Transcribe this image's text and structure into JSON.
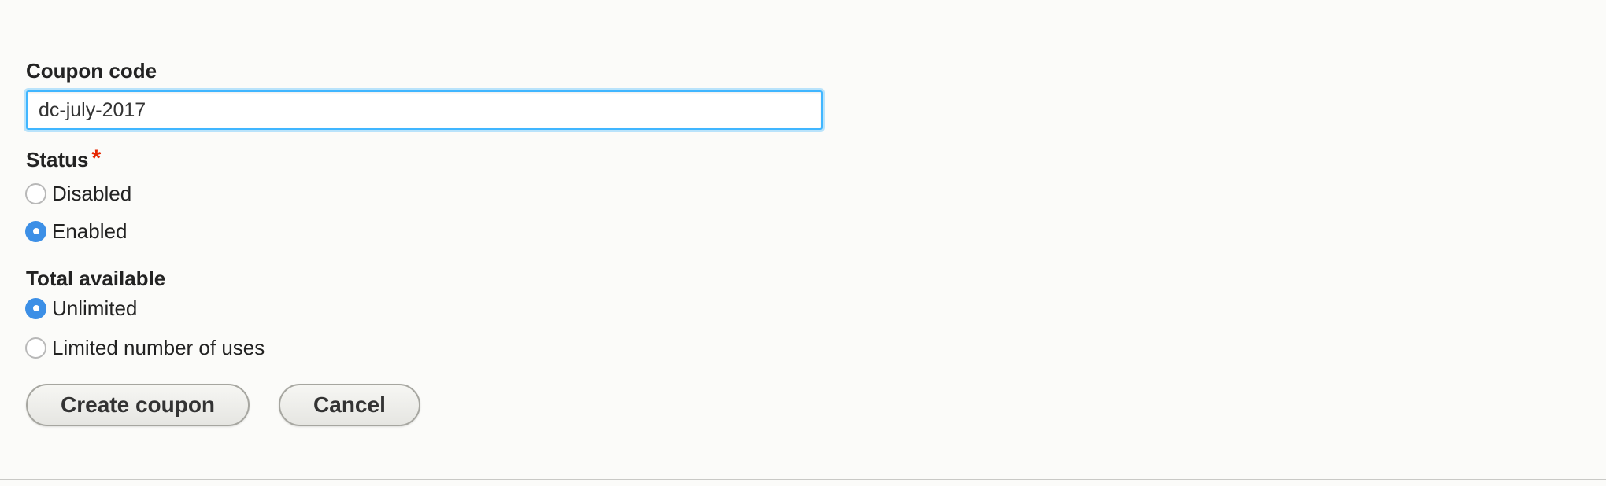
{
  "coupon_code": {
    "label": "Coupon code",
    "value": "dc-july-2017"
  },
  "status": {
    "label": "Status",
    "required_marker": "*",
    "options": [
      {
        "label": "Disabled",
        "checked": false
      },
      {
        "label": "Enabled",
        "checked": true
      }
    ]
  },
  "total_available": {
    "label": "Total available",
    "options": [
      {
        "label": "Unlimited",
        "checked": true
      },
      {
        "label": "Limited number of uses",
        "checked": false
      }
    ]
  },
  "actions": {
    "create_label": "Create coupon",
    "cancel_label": "Cancel"
  },
  "colors": {
    "accent": "#3c8fe6",
    "focus_ring": "#40b6ff",
    "required": "#e62600",
    "background": "#fbfbf9"
  }
}
